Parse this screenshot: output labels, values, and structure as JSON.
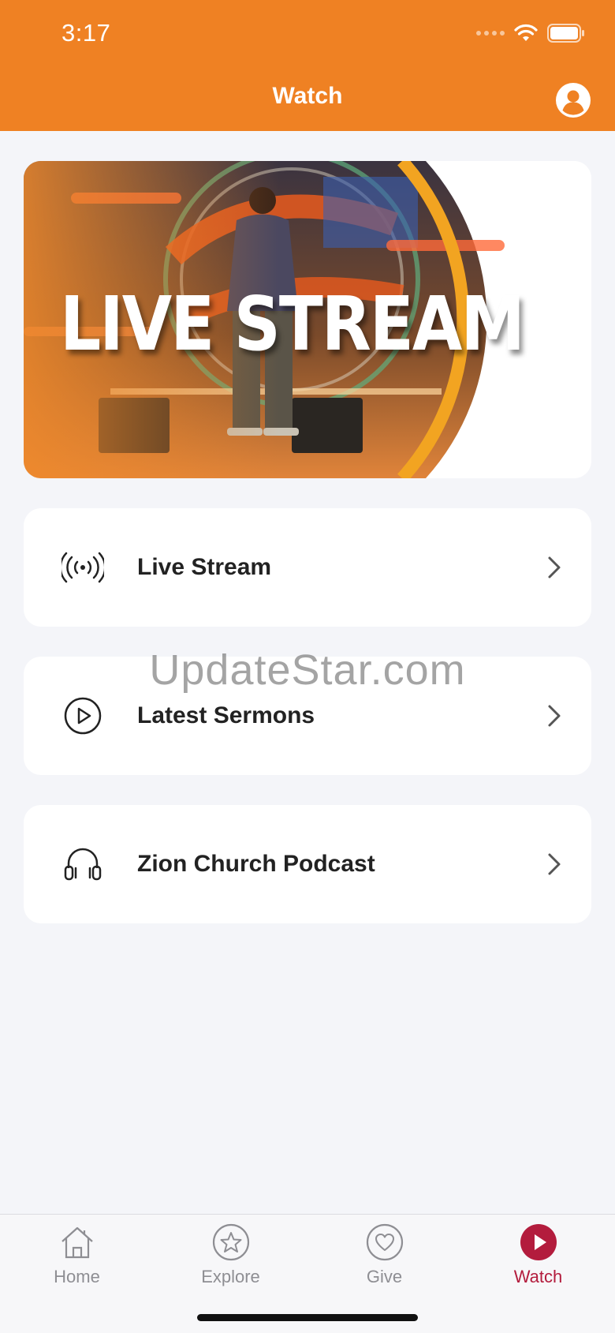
{
  "status": {
    "time": "3:17"
  },
  "header": {
    "title": "Watch"
  },
  "banner": {
    "text": "LIVE STREAM"
  },
  "menu": [
    {
      "label": "Live Stream",
      "icon": "broadcast-icon"
    },
    {
      "label": "Latest Sermons",
      "icon": "play-circle-icon"
    },
    {
      "label": "Zion Church Podcast",
      "icon": "headphones-icon"
    }
  ],
  "watermark": "UpdateStar.com",
  "tabs": [
    {
      "label": "Home",
      "icon": "home-icon"
    },
    {
      "label": "Explore",
      "icon": "star-icon"
    },
    {
      "label": "Give",
      "icon": "heart-icon"
    },
    {
      "label": "Watch",
      "icon": "play-icon",
      "active": true
    }
  ],
  "colors": {
    "header": "#ef8123",
    "active_tab": "#b31c3d",
    "background": "#f4f5f9"
  }
}
